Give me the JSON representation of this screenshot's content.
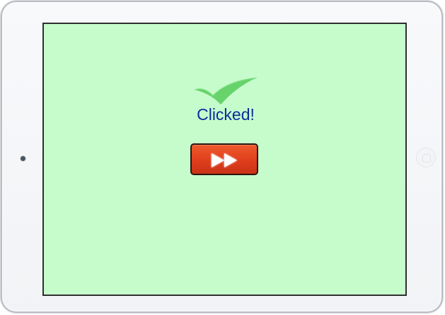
{
  "device": {
    "camera_icon": "camera-icon",
    "home_button_icon": "home-button-icon"
  },
  "screen": {
    "background_color": "#c6fccc",
    "status_icon": "checkmark-icon",
    "status_text": "Clicked!",
    "status_text_color": "#0a2d9a",
    "action_button": {
      "icon": "fast-forward-icon",
      "color": "#e2441f"
    }
  }
}
